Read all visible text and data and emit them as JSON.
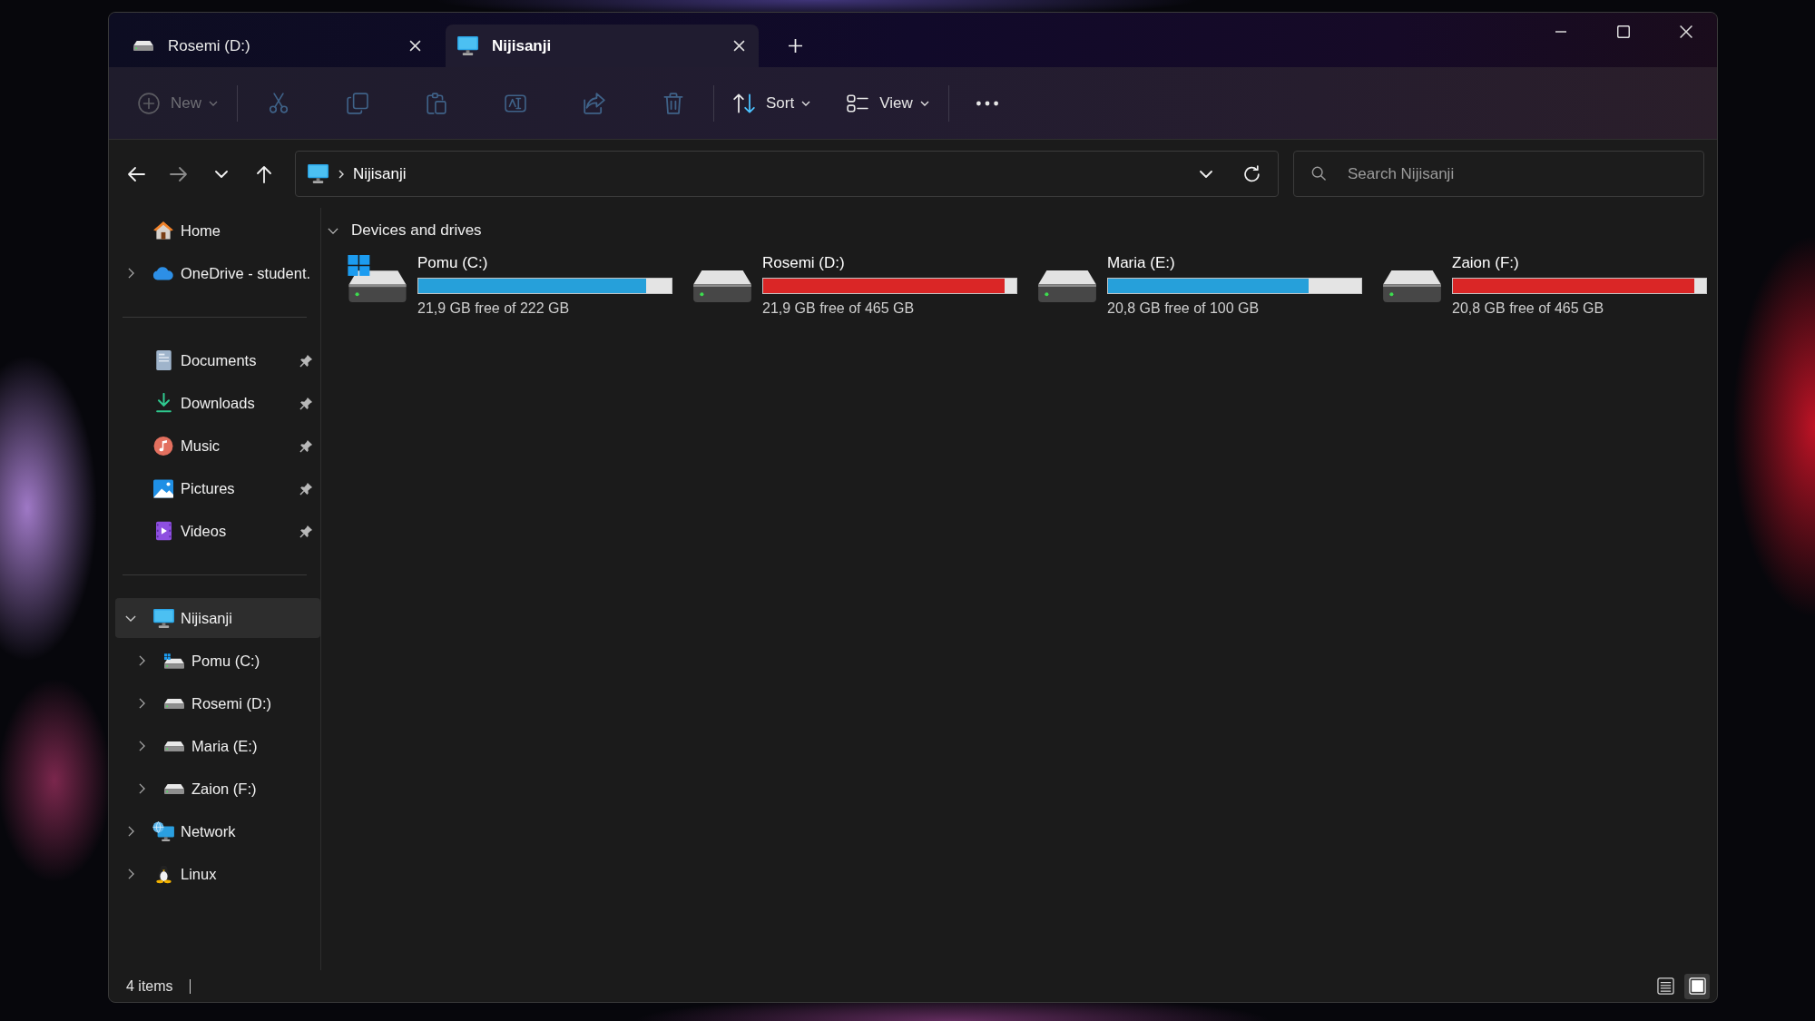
{
  "window": {
    "tabs": [
      {
        "label": "Rosemi (D:)",
        "kind": "drive",
        "selected": false
      },
      {
        "label": "Nijisanji",
        "kind": "computer",
        "selected": true
      }
    ]
  },
  "toolbar": {
    "groups": [
      {
        "items": [
          {
            "kind": "new",
            "label": "New",
            "disabled": true
          }
        ]
      },
      {
        "items": [
          {
            "kind": "cut",
            "disabled": true
          },
          {
            "kind": "copy",
            "disabled": true
          },
          {
            "kind": "paste",
            "disabled": true
          },
          {
            "kind": "rename",
            "disabled": true
          },
          {
            "kind": "share",
            "disabled": true
          },
          {
            "kind": "delete",
            "disabled": true
          }
        ]
      },
      {
        "items": [
          {
            "kind": "sort",
            "label": "Sort",
            "disabled": false
          },
          {
            "kind": "view",
            "label": "View",
            "disabled": false
          }
        ]
      },
      {
        "items": [
          {
            "kind": "more",
            "disabled": false
          }
        ]
      }
    ]
  },
  "navigation": {
    "buttons": [
      {
        "kind": "back",
        "disabled": false
      },
      {
        "kind": "forward",
        "disabled": true
      },
      {
        "kind": "recent",
        "disabled": false
      },
      {
        "kind": "up",
        "disabled": false
      }
    ]
  },
  "address_bar": {
    "kind": "computer",
    "path": [
      "Nijisanji"
    ]
  },
  "search": {
    "placeholder": "Search Nijisanji"
  },
  "sidebar": {
    "sections": [
      {
        "items": [
          {
            "label": "Home",
            "kind": "home",
            "selected": false
          },
          {
            "label": "OneDrive - student.",
            "kind": "cloud",
            "selected": false,
            "expanded": false
          }
        ]
      },
      {
        "items": [
          {
            "label": "Documents",
            "kind": "documents",
            "selected": false,
            "pinned": true
          },
          {
            "label": "Downloads",
            "kind": "downloads",
            "selected": false,
            "pinned": true
          },
          {
            "label": "Music",
            "kind": "music",
            "selected": false,
            "pinned": true
          },
          {
            "label": "Pictures",
            "kind": "pictures",
            "selected": false,
            "pinned": true
          },
          {
            "label": "Videos",
            "kind": "videos",
            "selected": false,
            "pinned": true
          }
        ]
      },
      {
        "items": [
          {
            "label": "Nijisanji",
            "kind": "computer",
            "selected": true,
            "expanded": true,
            "children": [
              {
                "label": "Pomu (C:)",
                "kind": "system-drive",
                "selected": false,
                "expanded": false
              },
              {
                "label": "Rosemi (D:)",
                "kind": "drive",
                "selected": false,
                "expanded": false
              },
              {
                "label": "Maria (E:)",
                "kind": "drive",
                "selected": false,
                "expanded": false
              },
              {
                "label": "Zaion (F:)",
                "kind": "drive",
                "selected": false,
                "expanded": false
              }
            ]
          },
          {
            "label": "Network",
            "kind": "network",
            "selected": false,
            "expanded": false
          },
          {
            "label": "Linux",
            "kind": "linux",
            "selected": false,
            "expanded": false
          }
        ]
      }
    ]
  },
  "content": {
    "groups": [
      {
        "title": "Devices and drives",
        "expanded": true,
        "drives": [
          {
            "name": "Pomu (C:)",
            "kind": "system",
            "level": 0.9,
            "low_space": false,
            "free": "21,9 GB free of 222 GB"
          },
          {
            "name": "Rosemi (D:)",
            "kind": "local",
            "level": 0.953,
            "low_space": true,
            "free": "21,9 GB free of 465 GB"
          },
          {
            "name": "Maria (E:)",
            "kind": "local",
            "level": 0.792,
            "low_space": false,
            "free": "20,8 GB free of 100 GB"
          },
          {
            "name": "Zaion (F:)",
            "kind": "local",
            "level": 0.955,
            "low_space": true,
            "free": "20,8 GB free of 465 GB"
          }
        ]
      }
    ]
  },
  "status_bar": {
    "item_count": "4 items",
    "view_modes": [
      {
        "kind": "details",
        "selected": false
      },
      {
        "kind": "tiles",
        "selected": true
      }
    ]
  }
}
